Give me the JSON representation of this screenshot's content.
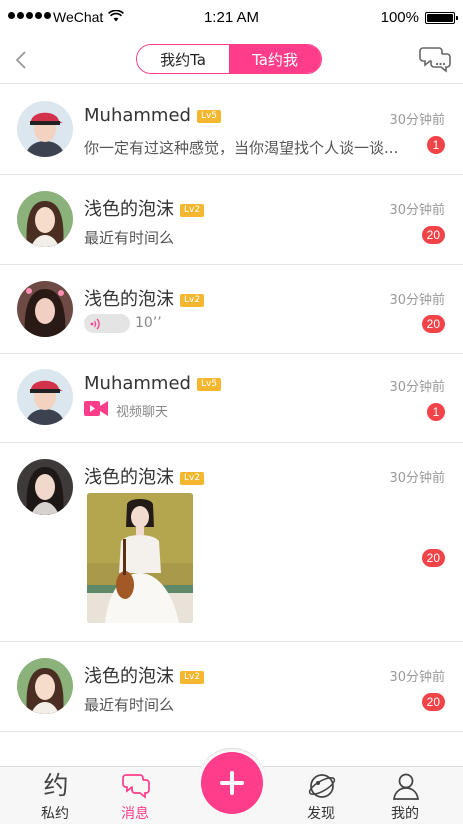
{
  "status_bar": {
    "carrier": "WeChat",
    "time": "1:21 AM",
    "battery": "100%"
  },
  "nav": {
    "tab_left": "我约Ta",
    "tab_right": "Ta约我"
  },
  "rows": [
    {
      "name": "Muhammed",
      "level": "Lv5",
      "time": "30分钟前",
      "preview": "你一定有过这种感觉，当你渴望找个人谈一谈...",
      "badge": "1"
    },
    {
      "name": "浅色的泡沫",
      "level": "Lv2",
      "time": "30分钟前",
      "preview": "最近有时间么",
      "badge": "20"
    },
    {
      "name": "浅色的泡沫",
      "level": "Lv2",
      "time": "30分钟前",
      "voice_duration": "10’’",
      "badge": "20"
    },
    {
      "name": "Muhammed",
      "level": "Lv5",
      "time": "30分钟前",
      "preview": "视频聊天",
      "badge": "1"
    },
    {
      "name": "浅色的泡沫",
      "level": "Lv2",
      "time": "30分钟前",
      "badge": "20"
    },
    {
      "name": "浅色的泡沫",
      "level": "Lv2",
      "time": "30分钟前",
      "preview": "最近有时间么",
      "badge": "20"
    }
  ],
  "tabs": [
    {
      "label": "私约",
      "icon": "yue-char-icon"
    },
    {
      "label": "消息",
      "icon": "chat-bubbles-icon",
      "active": true
    },
    {
      "label": "发现",
      "icon": "planet-icon"
    },
    {
      "label": "我的",
      "icon": "person-icon"
    }
  ],
  "tab_glyph": "约",
  "colors": {
    "accent": "#ff3d8b",
    "badge": "#f04448",
    "level": "#f5b730"
  }
}
